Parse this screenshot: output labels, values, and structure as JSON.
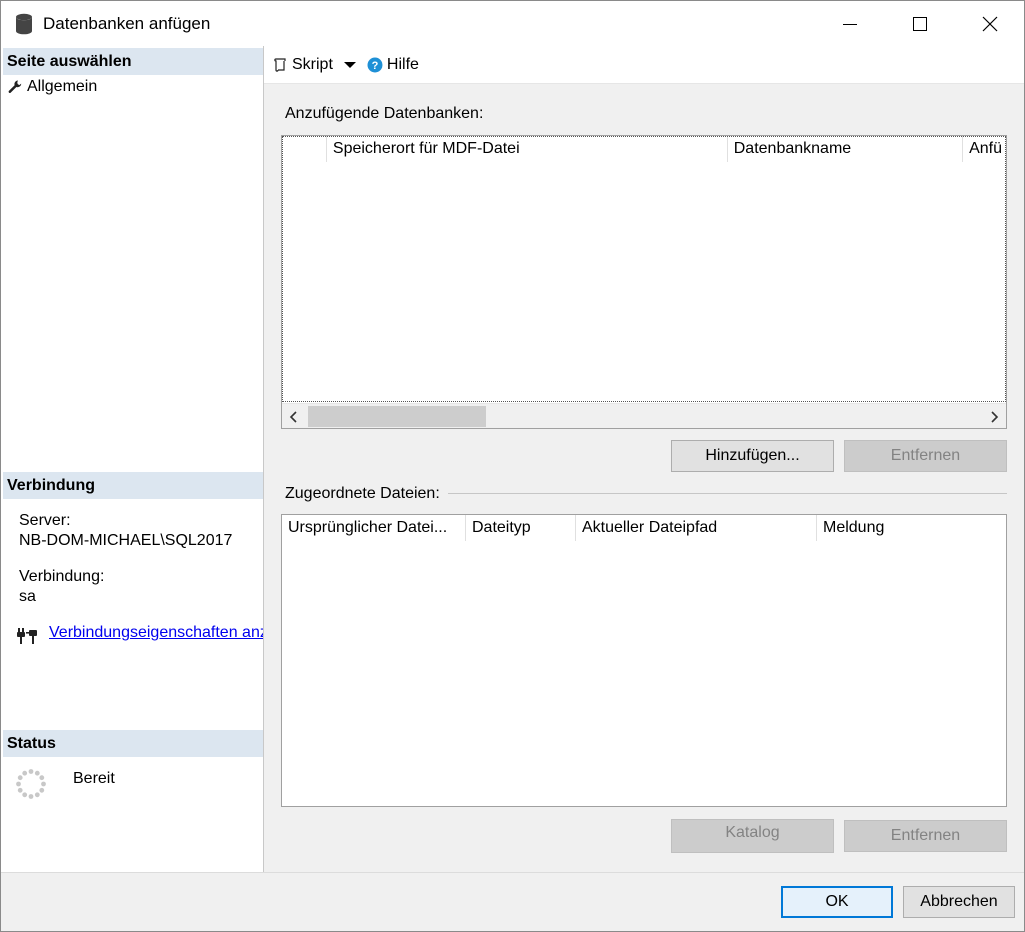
{
  "window": {
    "title": "Datenbanken anfügen"
  },
  "left": {
    "select_page_header": "Seite auswählen",
    "nav_items": [
      {
        "label": "Allgemein",
        "icon": "wrench-icon"
      }
    ],
    "connection_header": "Verbindung",
    "server_label": "Server:",
    "server_value": "NB-DOM-MICHAEL\\SQL2017",
    "connection_label": "Verbindung:",
    "connection_value": "sa",
    "connection_props_link": "Verbindungseigenschaften anzeigen",
    "status_header": "Status",
    "status_value": "Bereit"
  },
  "toolbar": {
    "script_label": "Skript",
    "help_label": "Hilfe"
  },
  "databases": {
    "label": "Anzufügende Datenbanken:",
    "columns": [
      "",
      "Speicherort für MDF-Datei",
      "Datenbankname",
      "Anfü"
    ],
    "rows": [],
    "add_button": "Hinzufügen...",
    "remove_button": "Entfernen"
  },
  "files": {
    "label": "Zugeordnete Dateien:",
    "columns": [
      "Ursprünglicher Datei...",
      "Dateityp",
      "Aktueller Dateipfad",
      "Meldung"
    ],
    "rows": [],
    "catalog_button": "Katalog",
    "remove_button": "Entfernen"
  },
  "footer": {
    "ok_button": "OK",
    "cancel_button": "Abbrechen"
  },
  "colors": {
    "section_header_bg": "#dce6f0",
    "link": "#0000ee",
    "help_icon": "#1e90d6",
    "default_button_border": "#0078d7"
  }
}
